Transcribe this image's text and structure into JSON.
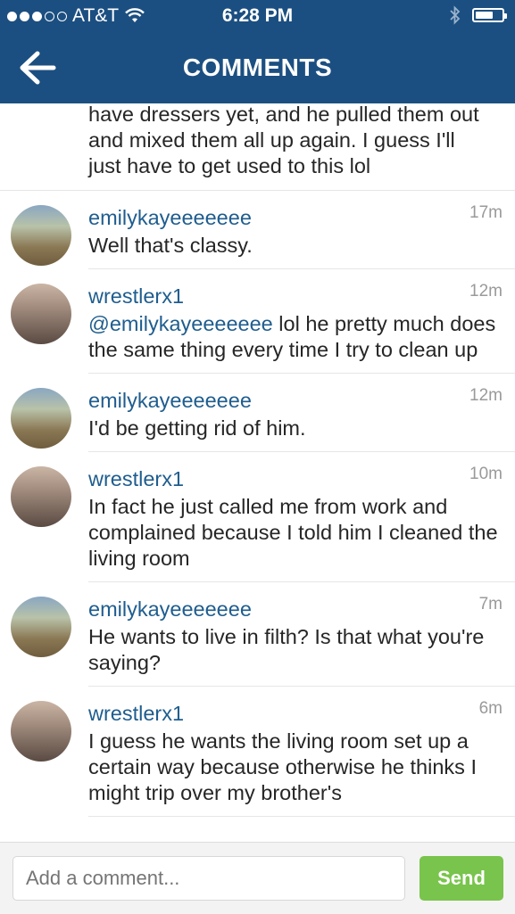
{
  "status": {
    "carrier": "AT&T",
    "time": "6:28 PM",
    "icons": [
      "signal-dots",
      "wifi-icon",
      "bluetooth-icon",
      "battery-icon"
    ]
  },
  "nav": {
    "back_icon": "back-arrow-icon",
    "title": "COMMENTS"
  },
  "partial_comment": {
    "text": "have dressers yet, and he pulled them out and mixed them all up again. I guess I'll just have to get used to this lol"
  },
  "comments": [
    {
      "user": "emilykayeeeeeee",
      "age": "17m",
      "text": "Well that's classy."
    },
    {
      "user": "wrestlerx1",
      "age": "12m",
      "mention": "@emilykayeeeeeee",
      "text": " lol he pretty much does the same thing every time I try to clean up"
    },
    {
      "user": "emilykayeeeeeee",
      "age": "12m",
      "text": "I'd be getting rid of him."
    },
    {
      "user": "wrestlerx1",
      "age": "10m",
      "text": "In fact he just called me from work and complained because I told him I cleaned the living room"
    },
    {
      "user": "emilykayeeeeeee",
      "age": "7m",
      "text": "He wants to live in filth? Is that what you're saying?"
    },
    {
      "user": "wrestlerx1",
      "age": "6m",
      "text": "I guess he wants the living room set up a certain way because otherwise he thinks I might trip over my brother's"
    }
  ],
  "composer": {
    "placeholder": "Add a comment...",
    "send_label": "Send"
  },
  "colors": {
    "header": "#1c4f81",
    "username": "#1f5d8e",
    "send": "#79c44c"
  }
}
